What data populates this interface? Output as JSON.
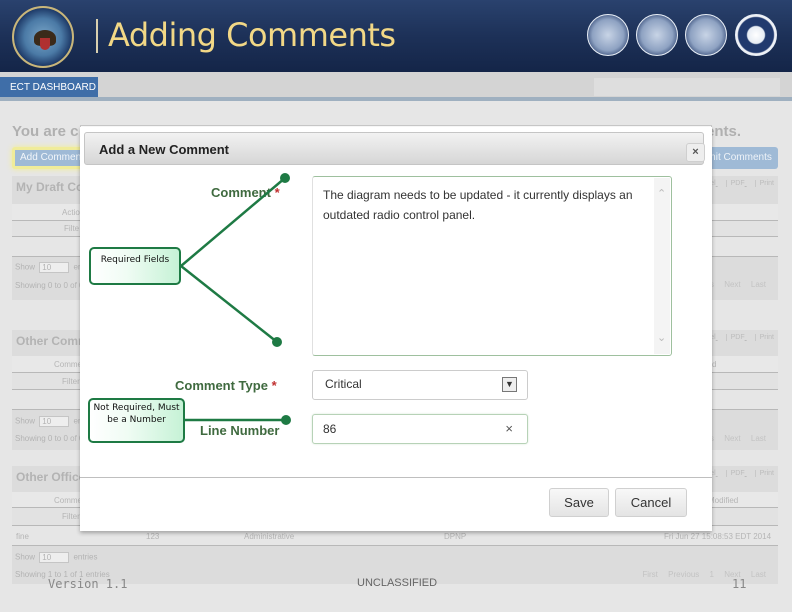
{
  "header": {
    "title": "Adding Comments",
    "logos": [
      "dod-seal",
      "army-seal",
      "marine-corps-seal",
      "navy-seal",
      "air-force-seal"
    ]
  },
  "nav": {
    "tab_label": "ECT DASHBOARD"
  },
  "background_page": {
    "heading_left": "You are c",
    "heading_right": "ents.",
    "add_comment_button": "Add Comment",
    "submit_comments_button": "nit Comments",
    "panels": [
      {
        "title": "My Draft Co",
        "column_label": "Actio",
        "filter_label": "Filte",
        "export_links": [
          "xcel",
          "PDF",
          "Print"
        ],
        "show_label": "Show",
        "show_value": "10",
        "entries_label": "ent",
        "showing_text": "Showing 0 to 0 of 0",
        "pager": [
          "ous",
          "Next",
          "Last"
        ]
      },
      {
        "title": "Other Comm",
        "column_label": "Comme",
        "filter_label": "Filter",
        "export_links": [
          "xcel",
          "PDF",
          "Print"
        ],
        "sort_col": "d",
        "show_label": "Show",
        "show_value": "10",
        "entries_label": "ent",
        "showing_text": "Showing 0 to 0 of 0",
        "pager": [
          "ous",
          "Next",
          "Last"
        ]
      },
      {
        "title": "Other Office",
        "column_label": "Comme",
        "filter_label": "Filter",
        "export_links": [
          "xcel",
          "PDF",
          "Print"
        ],
        "sort_col": "Modified",
        "row": {
          "col1": "fine",
          "col2": "123",
          "col3": "Administrative",
          "col4": "DPNP",
          "col5": "Fri Jun 27 15:08:53 EDT 2014"
        },
        "show_label": "Show",
        "show_value": "10",
        "entries_label": "entries",
        "showing_text": "Showing 1 to 1 of 1 entries",
        "pager": [
          "First",
          "Previous",
          "1",
          "Next",
          "Last"
        ]
      }
    ]
  },
  "modal": {
    "title": "Add a New Comment",
    "close_icon": "×",
    "comment_label": "Comment",
    "comment_value": "The diagram needs to be updated - it currently displays an outdated radio control panel.",
    "comment_type_label": "Comment Type",
    "comment_type_value": "Critical",
    "line_number_label": "Line Number",
    "line_number_value": "86",
    "required_mark": "*",
    "clear_icon": "×",
    "save_label": "Save",
    "cancel_label": "Cancel"
  },
  "callouts": {
    "required": "Required Fields",
    "not_required": "Not Required, Must be a Number"
  },
  "annotation_color": "#1e7a44",
  "footer": {
    "version": "Version 1.1",
    "classification": "UNCLASSIFIED",
    "page_number": "11"
  }
}
